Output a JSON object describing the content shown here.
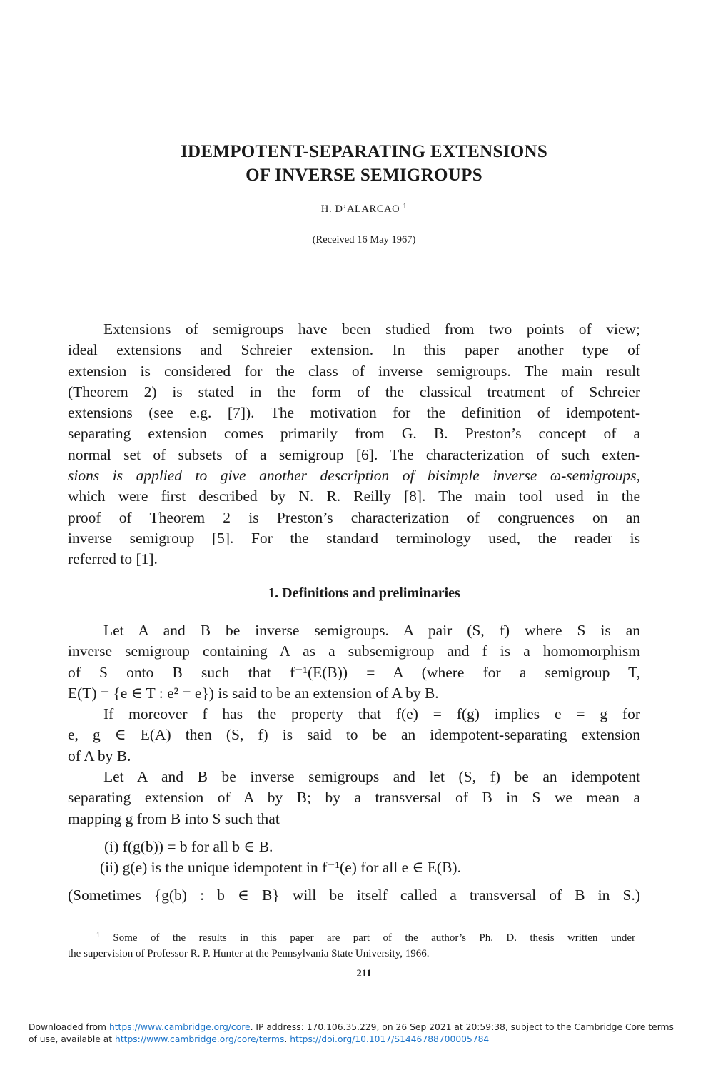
{
  "header": {
    "title_line1": "IDEMPOTENT-SEPARATING EXTENSIONS",
    "title_line2": "OF INVERSE SEMIGROUPS",
    "author": "H. D’ALARCAO",
    "author_footnote_mark": "1",
    "received": "(Received 16 May 1967)"
  },
  "abstract": {
    "lines": [
      "Extensions of semigroups have been studied from two points of view;",
      "ideal extensions and Schreier extension. In this paper another type of",
      "extension is considered for the class of inverse semigroups. The main result",
      "(Theorem 2) is stated in the form of the classical treatment of Schreier",
      "extensions (see e.g. [7]). The motivation for the definition of idempotent-",
      "separating extension comes primarily from G. B. Preston’s concept of a",
      "normal set of subsets of a semigroup [6]. The characterization of such exten-",
      "sions is applied to give another description of bisimple inverse ω-semigroups,",
      "which were first described by N. R. Reilly [8]. The main tool used in the",
      "proof of Theorem 2 is Preston’s characterization of congruences on an",
      "inverse semigroup [5]. For the standard terminology used, the reader is",
      "referred to [1]."
    ]
  },
  "section": {
    "heading": "1. Definitions and preliminaries"
  },
  "definitions": {
    "para1": [
      "Let A and B be inverse semigroups. A pair (S, f) where S is an",
      "inverse semigroup containing A as a subsemigroup and f is a homomorphism",
      "of S onto B such that f⁻¹(E(B)) = A (where for a semigroup T,",
      "E(T) = {e ∈ T : e² = e}) is said to be an extension of A by B."
    ],
    "extension_term": "extension",
    "para2": [
      "If moreover f has the property that f(e) = f(g) implies e = g for",
      "e, g ∈ E(A) then (S, f) is said to be an idempotent-separating extension",
      "of A by B."
    ],
    "ise_term": "idempotent-separating extension",
    "para3": [
      "Let A and B be inverse semigroups and let (S, f) be an idempotent",
      "separating extension of A by B; by a transversal of B in S we mean a",
      "mapping g from B into S such that"
    ],
    "transversal_term": "transversal",
    "conditions": [
      {
        "label": "(i)",
        "text": "f(g(b)) = b for all b ∈ B."
      },
      {
        "label": "(ii)",
        "text": "g(e) is the unique idempotent in f⁻¹(e) for all e ∈ E(B)."
      }
    ],
    "remark": "(Sometimes {g(b) : b ∈ B} will be itself called a transversal of B in S.)"
  },
  "footnote": {
    "mark": "1",
    "lines": [
      "Some of the results in this paper are part of the author’s Ph. D. thesis written under",
      "the supervision of Professor R. P. Hunter at the Pennsylvania State University, 1966."
    ]
  },
  "page_number": "211",
  "download_notice": {
    "prefix": "Downloaded from ",
    "link1": "https://www.cambridge.org/core",
    "middle": ". IP address: 170.106.35.229, on 26 Sep 2021 at 20:59:38, subject to the Cambridge Core terms",
    "line2_prefix": "of use, available at ",
    "link2": "https://www.cambridge.org/core/terms",
    "sep": ". ",
    "link3": "https://doi.org/10.1017/S1446788700005784",
    "link_color": "#1a73c8"
  }
}
